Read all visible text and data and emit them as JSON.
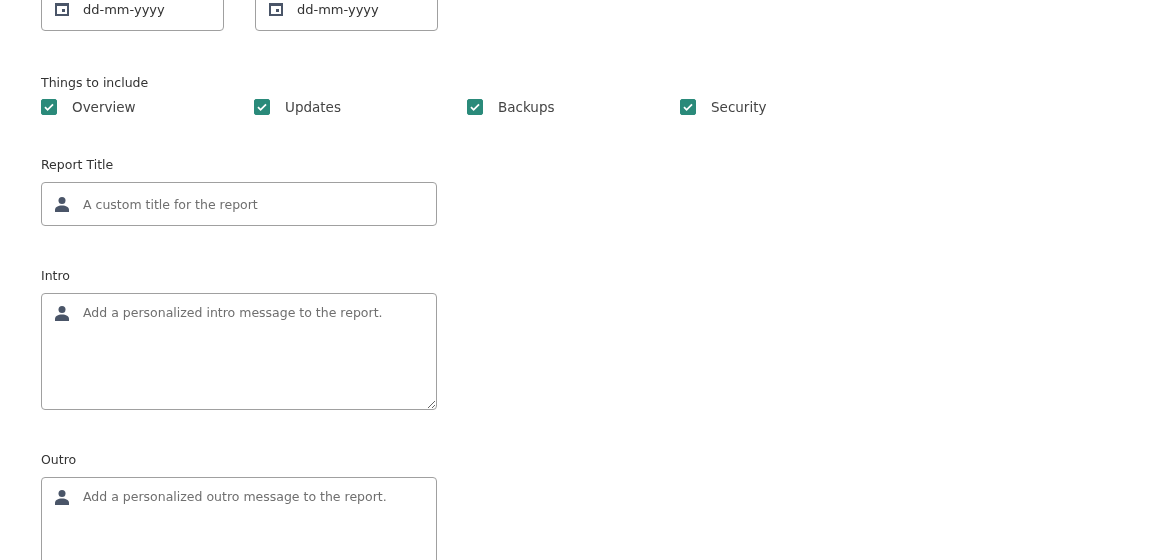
{
  "date_fields": [
    {
      "placeholder": "dd-mm-yyyy"
    },
    {
      "placeholder": "dd-mm-yyyy"
    }
  ],
  "include": {
    "label": "Things to include",
    "options": [
      {
        "label": "Overview",
        "checked": true
      },
      {
        "label": "Updates",
        "checked": true
      },
      {
        "label": "Backups",
        "checked": true
      },
      {
        "label": "Security",
        "checked": true
      }
    ]
  },
  "fields": [
    {
      "kind": "text",
      "label": "Report Title",
      "placeholder": "A custom title for the report"
    },
    {
      "kind": "textarea",
      "label": "Intro",
      "placeholder": "Add a personalized intro message to the report."
    },
    {
      "kind": "textarea",
      "label": "Outro",
      "placeholder": "Add a personalized outro message to the report."
    }
  ]
}
